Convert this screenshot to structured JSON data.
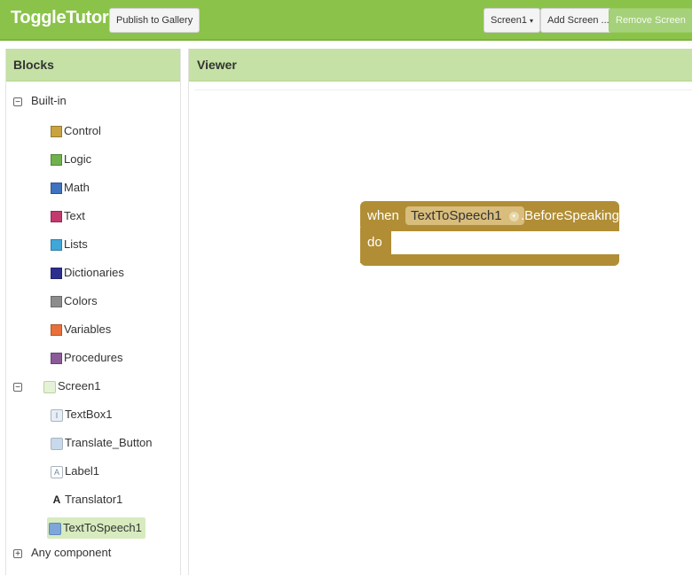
{
  "header": {
    "app_title": "ToggleTutorial",
    "publish_label": "Publish to Gallery",
    "screen_dropdown": "Screen1",
    "add_screen_label": "Add Screen ...",
    "remove_screen_label": "Remove Screen"
  },
  "blocks_panel": {
    "title": "Blocks",
    "builtin": {
      "label": "Built-in",
      "items": [
        {
          "label": "Control",
          "color": "#c8a33f"
        },
        {
          "label": "Logic",
          "color": "#6fb24d"
        },
        {
          "label": "Math",
          "color": "#3f72c0"
        },
        {
          "label": "Text",
          "color": "#c23a6e"
        },
        {
          "label": "Lists",
          "color": "#40a7d8"
        },
        {
          "label": "Dictionaries",
          "color": "#2d2f8f"
        },
        {
          "label": "Colors",
          "color": "#8c8c8c"
        },
        {
          "label": "Variables",
          "color": "#e9703a"
        },
        {
          "label": "Procedures",
          "color": "#8a5b99"
        }
      ]
    },
    "screen": {
      "label": "Screen1",
      "components": [
        {
          "label": "TextBox1",
          "icon": "textbox-icon"
        },
        {
          "label": "Translate_Button",
          "icon": "button-icon"
        },
        {
          "label": "Label1",
          "icon": "label-icon"
        },
        {
          "label": "Translator1",
          "icon": "translator-icon"
        },
        {
          "label": "TextToSpeech1",
          "icon": "speech-icon"
        }
      ]
    },
    "any_component": "Any component"
  },
  "viewer": {
    "title": "Viewer",
    "event_block": {
      "when": "when",
      "component": "TextToSpeech1",
      "event": ".BeforeSpeaking",
      "do": "do",
      "color": "#b18e35"
    }
  }
}
